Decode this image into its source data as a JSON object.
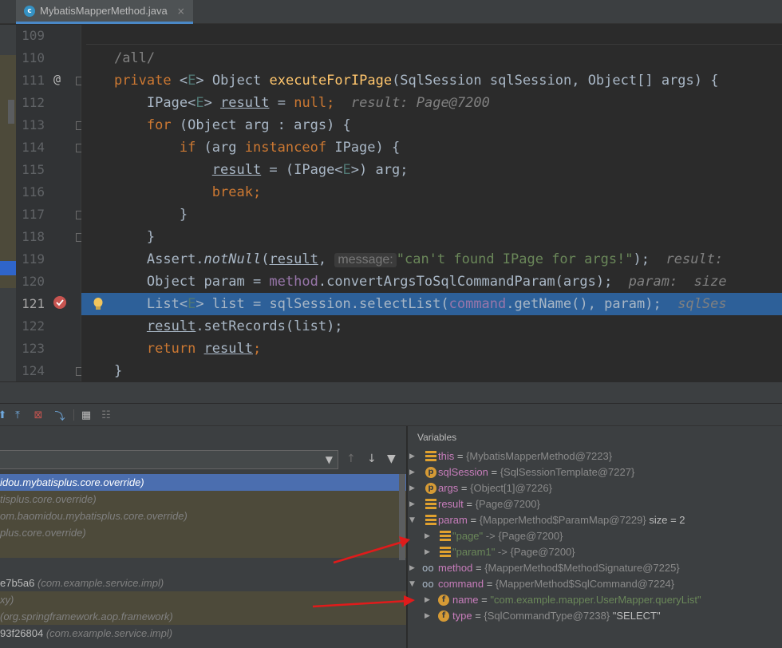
{
  "tab": {
    "icon_letter": "c",
    "label": "MybatisMapperMethod.java",
    "close": "×"
  },
  "editor": {
    "lines": [
      {
        "num": "109"
      },
      {
        "num": "110",
        "code": "/all/"
      },
      {
        "num": "111",
        "gicon": "@"
      },
      {
        "num": "112",
        "hint": "result: Page@7200"
      },
      {
        "num": "113"
      },
      {
        "num": "114"
      },
      {
        "num": "115"
      },
      {
        "num": "116"
      },
      {
        "num": "117"
      },
      {
        "num": "118"
      },
      {
        "num": "119",
        "hint_label": "message:",
        "hint": "result:"
      },
      {
        "num": "120",
        "hint": "param:  size"
      },
      {
        "num": "121",
        "hint": "sqlSes"
      },
      {
        "num": "122"
      },
      {
        "num": "123"
      },
      {
        "num": "124"
      }
    ],
    "code": {
      "l111": {
        "kw": "private",
        "g1": "<",
        "E": "E",
        "g2": ">",
        "type": "Object",
        "fn": "executeForIPage",
        "params": "(SqlSession sqlSession, Object[] args) {"
      },
      "l112": {
        "type": "IPage",
        "E": "E",
        "var": "result",
        "eq": " = ",
        "nul": "null",
        "semi": ";"
      },
      "l113": {
        "kw": "for",
        "rest": " (Object arg : args) {"
      },
      "l114": {
        "kw": "if",
        "p1": " (arg ",
        "kw2": "instanceof",
        "p2": " IPage) {"
      },
      "l115": {
        "var": "result",
        "p1": " = (IPage<",
        "E": "E",
        "p2": ">) arg;"
      },
      "l116": {
        "kw": "break",
        "semi": ";"
      },
      "l117": {
        "t": "}"
      },
      "l118": {
        "t": "}"
      },
      "l119": {
        "cls": "Assert.",
        "fn": "notNull",
        "p1": "(",
        "var": "result",
        "p2": ", ",
        "str": "\"can't found IPage for args!\"",
        "p3": ");"
      },
      "l120": {
        "p1": "Object param = ",
        "fld": "method",
        "p2": ".convertArgsToSqlCommandParam(args);"
      },
      "l121": {
        "p1": "List<",
        "E": "E",
        "p2": "> list = sqlSession.selectList(",
        "fld": "command",
        "p3": ".getName(), param);"
      },
      "l122": {
        "var": "result",
        "p1": ".setRecords(list);"
      },
      "l123": {
        "kw": "return",
        "sp": " ",
        "var": "result",
        "semi": ";"
      },
      "l124": {
        "t": "}"
      }
    }
  },
  "toolbar": {
    "icons": [
      "step-out-icon",
      "drop-frame-icon",
      "run-to-cursor-icon",
      "evaluate-icon",
      "trace-icon"
    ]
  },
  "frames": {
    "rows": [
      {
        "text": "idou.mybatisplus.core.override)",
        "kind": "sel"
      },
      {
        "text": "tisplus.core.override)",
        "kind": "lib"
      },
      {
        "text": "om.baomidou.mybatisplus.core.override)",
        "kind": "lib"
      },
      {
        "text": "plus.core.override)",
        "kind": "lib"
      },
      {
        "text": "",
        "kind": "lib"
      },
      {
        "m": "e7b5a6",
        "text": " (com.example.service.impl)",
        "kind": "plain"
      },
      {
        "text": "xy)",
        "kind": "lib"
      },
      {
        "text": "(org.springframework.aop.framework)",
        "kind": "lib"
      },
      {
        "m": "93f26804",
        "text": " (com.example.service.impl)",
        "kind": "plain"
      }
    ]
  },
  "variables": {
    "title": "Variables",
    "rows": [
      {
        "icon": "bars",
        "name": "this",
        "eq": " = ",
        "val": "{MybatisMapperMethod@7223}",
        "indent": 0,
        "tri": "▶"
      },
      {
        "icon": "p",
        "name": "sqlSession",
        "eq": " = ",
        "val": "{SqlSessionTemplate@7227}",
        "indent": 0,
        "tri": "▶"
      },
      {
        "icon": "p",
        "name": "args",
        "eq": " = ",
        "val": "{Object[1]@7226}",
        "indent": 0,
        "tri": "▶"
      },
      {
        "icon": "bars",
        "name": "result",
        "eq": " = ",
        "val": "{Page@7200}",
        "indent": 0,
        "tri": "▶"
      },
      {
        "icon": "bars",
        "name": "param",
        "eq": " = ",
        "val": "{MapperMethod$ParamMap@7229}",
        "extra": "  size = 2",
        "indent": 0,
        "tri": "▼"
      },
      {
        "icon": "bars",
        "name": "\"page\"",
        "eq": " -> ",
        "val": "{Page@7200}",
        "indent": 1,
        "tri": "▶",
        "key": true
      },
      {
        "icon": "bars",
        "name": "\"param1\"",
        "eq": " -> ",
        "val": "{Page@7200}",
        "indent": 1,
        "tri": "▶",
        "key": true
      },
      {
        "icon": "oo",
        "name": "method",
        "eq": " = ",
        "val": "{MapperMethod$MethodSignature@7225}",
        "indent": 0,
        "tri": "▶"
      },
      {
        "icon": "oo",
        "name": "command",
        "eq": " = ",
        "val": "{MapperMethod$SqlCommand@7224}",
        "indent": 0,
        "tri": "▼"
      },
      {
        "icon": "f",
        "name": "name",
        "eq": " = ",
        "str": "\"com.example.mapper.UserMapper.queryList\"",
        "indent": 1,
        "tri": "▶"
      },
      {
        "icon": "f",
        "name": "type",
        "eq": " = ",
        "val": "{SqlCommandType@7238}",
        "extra": " \"SELECT\"",
        "indent": 1,
        "tri": "▶"
      }
    ]
  },
  "colors": {
    "arrow": "#e01b1b",
    "selection": "#2d6099",
    "frame_selected": "#4b6eaf"
  }
}
